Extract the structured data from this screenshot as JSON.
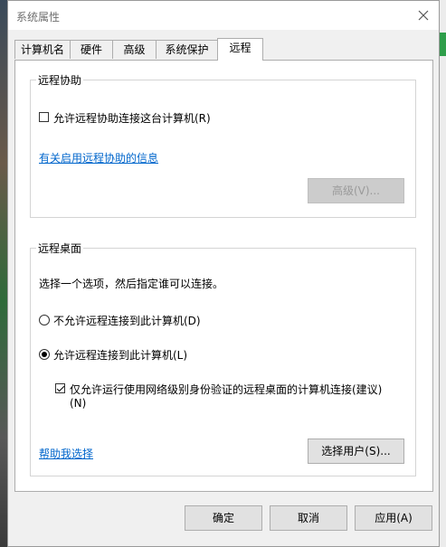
{
  "window": {
    "title": "系统属性"
  },
  "tabs": [
    {
      "label": "计算机名"
    },
    {
      "label": "硬件"
    },
    {
      "label": "高级"
    },
    {
      "label": "系统保护"
    },
    {
      "label": "远程",
      "active": true
    }
  ],
  "remote_assistance": {
    "heading": "远程协助",
    "allow_checkbox_label": "允许远程协助连接这台计算机(R)",
    "allow_checked": false,
    "info_link": "有关启用远程协助的信息",
    "advanced_button": "高级(V)..."
  },
  "remote_desktop": {
    "heading": "远程桌面",
    "instruction": "选择一个选项，然后指定谁可以连接。",
    "option_disallow": "不允许远程连接到此计算机(D)",
    "option_allow": "允许远程连接到此计算机(L)",
    "selected_option": "allow",
    "nla_checkbox_label": "仅允许运行使用网络级别身份验证的远程桌面的计算机连接(建议)",
    "nla_checkbox_label_line2": "(N)",
    "nla_checked": true,
    "help_link": "帮助我选择",
    "select_users_button": "选择用户(S)..."
  },
  "footer": {
    "ok_button": "确定",
    "cancel_button": "取消",
    "apply_button": "应用(A)"
  }
}
